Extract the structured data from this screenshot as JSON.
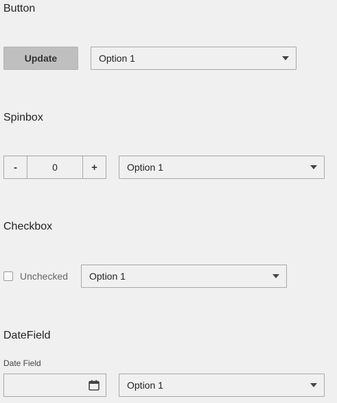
{
  "sections": {
    "button": {
      "title": "Button"
    },
    "spinbox": {
      "title": "Spinbox"
    },
    "checkbox": {
      "title": "Checkbox"
    },
    "datefield": {
      "title": "DateField"
    }
  },
  "button": {
    "label": "Update"
  },
  "spinbox": {
    "minus": "-",
    "value": "0",
    "plus": "+"
  },
  "checkbox": {
    "label": "Unchecked",
    "checked": false
  },
  "datefield": {
    "caption": "Date Field",
    "value": "",
    "icon": "calendar-icon"
  },
  "dropdowns": [
    {
      "value": "Option 1"
    },
    {
      "value": "Option 1"
    },
    {
      "value": "Option 1"
    },
    {
      "value": "Option 1"
    }
  ]
}
